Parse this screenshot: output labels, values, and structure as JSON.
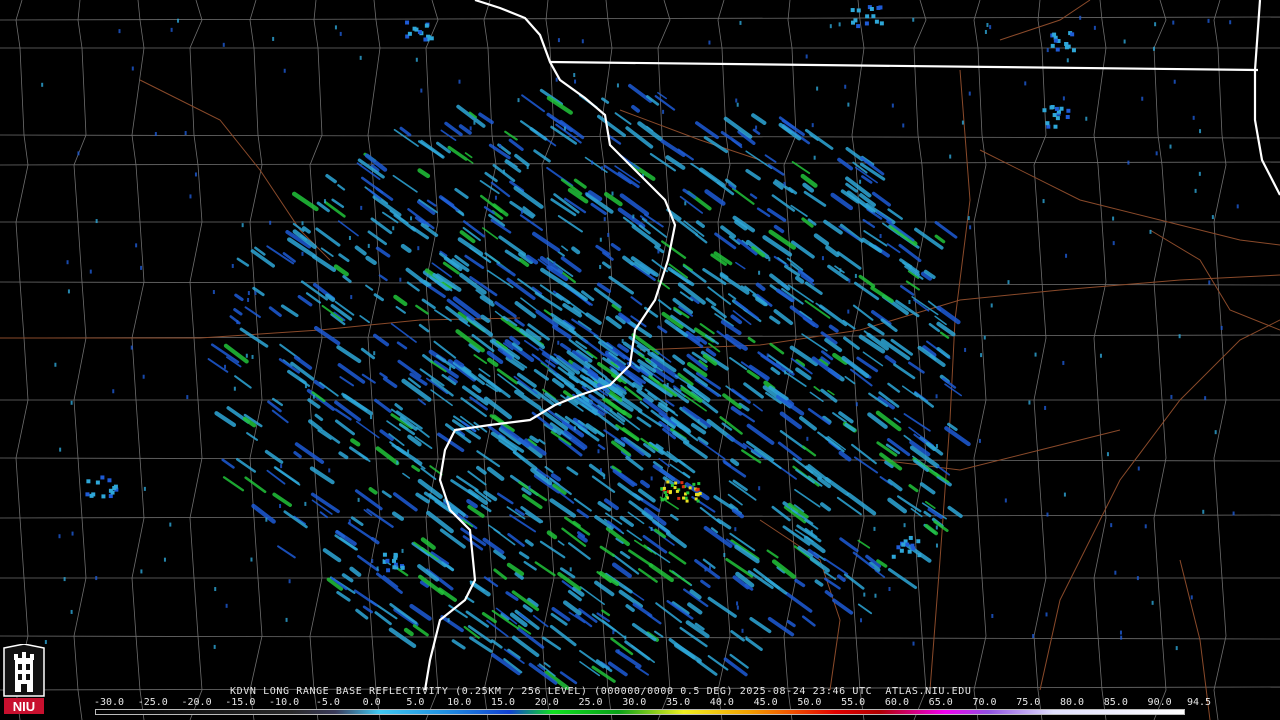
{
  "radar": {
    "title_line": "KDVN LONG RANGE BASE REFLECTIVITY (0.25KM / 256 LEVEL) (000000/0000 0.5 DEG) 2025-08-24 23:46 UTC  ATLAS.NIU.EDU",
    "scale_min": -30,
    "scale_max": 94.5,
    "scale_labels": [
      "-30.0",
      "-25.0",
      "-20.0",
      "-15.0",
      "-10.0",
      "-5.0",
      "0.0",
      "5.0",
      "10.0",
      "15.0",
      "20.0",
      "25.0",
      "30.0",
      "35.0",
      "40.0",
      "45.0",
      "50.0",
      "55.0",
      "60.0",
      "65.0",
      "70.0",
      "75.0",
      "80.0",
      "85.0",
      "90.0",
      "94.5"
    ],
    "colors": {
      "background": "#000000",
      "county_lines": "#6e6e6e",
      "highways": "#8a4a2a",
      "state_border": "#ffffff",
      "echo_light": "#2ea7d8",
      "echo_blue": "#1e5bd6",
      "echo_green": "#22c43a",
      "echo_yellow": "#e8e020",
      "echo_red": "#e03010"
    }
  },
  "logo": {
    "text": "NIU",
    "icon": "niu-tower-logo-icon"
  }
}
